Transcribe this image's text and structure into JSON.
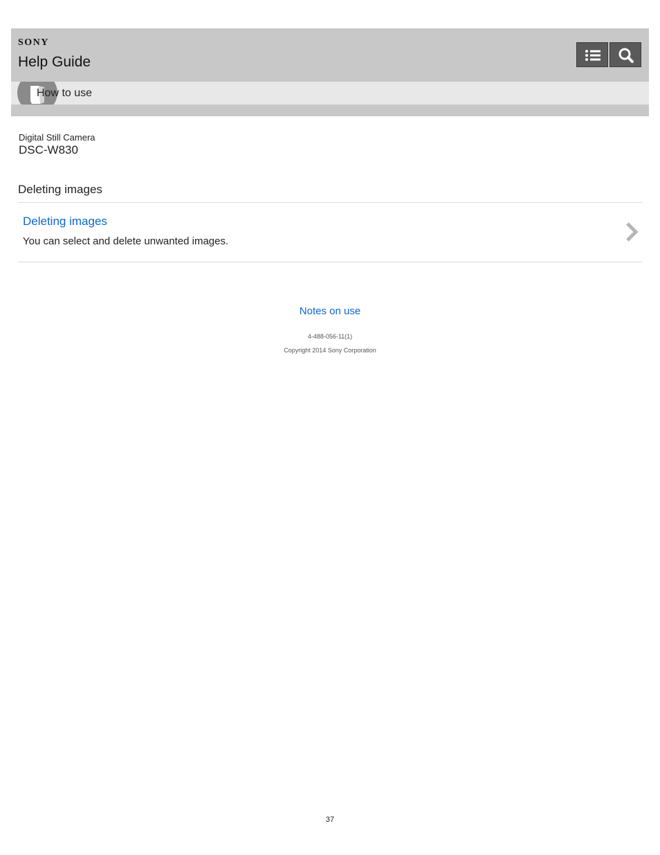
{
  "header": {
    "brand": "SONY",
    "title": "Help Guide",
    "menu_button_icon": "list-icon",
    "search_button_icon": "search-icon"
  },
  "subbar": {
    "icon": "book-icon",
    "label": "How to use"
  },
  "product": {
    "category": "Digital Still Camera",
    "model": "DSC-W830"
  },
  "section": {
    "title": "Deleting images"
  },
  "items": [
    {
      "title": "Deleting images",
      "description": "You can select and delete unwanted images.",
      "icon": "chevron-right-icon"
    }
  ],
  "footer": {
    "link": "Notes on use",
    "doc_number": "4-488-056-11(1)",
    "copyright": "Copyright 2014 Sony Corporation"
  },
  "page_number": "37",
  "colors": {
    "header_bg": "#c8c8c8",
    "subbar_bg": "#e8e8e8",
    "button_bg": "#5a5a5a",
    "link": "#0c67cf"
  }
}
